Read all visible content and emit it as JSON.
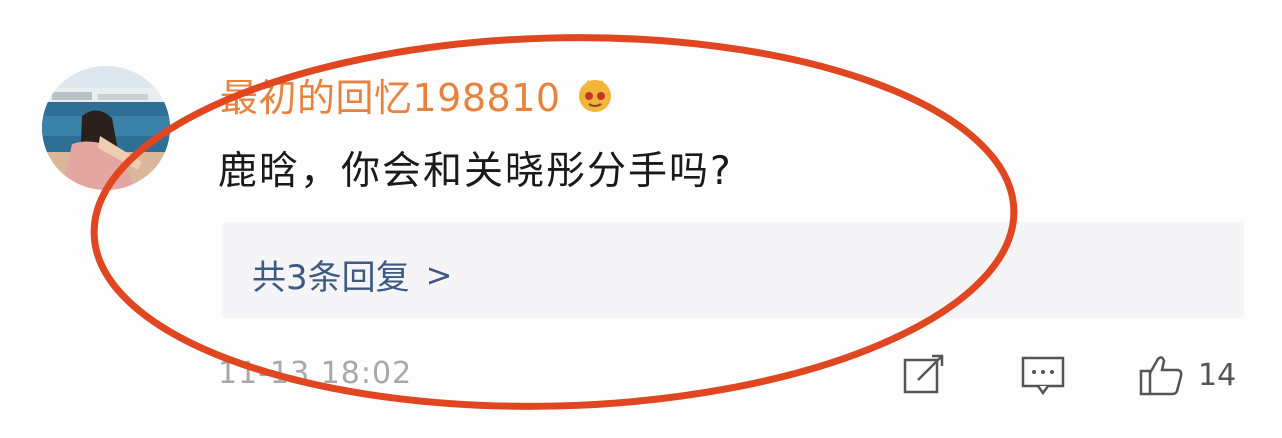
{
  "comment": {
    "username": "最初的回忆198810",
    "badge_icon": "crown-face-icon",
    "text": "鹿晗，你会和关晓彤分手吗?",
    "replies_label": "共3条回复",
    "replies_chevron": ">",
    "timestamp": "11-13 18:02",
    "like_count": "14"
  },
  "colors": {
    "username": "#e8823c",
    "reply_link": "#3f5a82",
    "highlight_ellipse": "#e0461f"
  },
  "icons": {
    "share": "share-edit-icon",
    "comment": "comment-bubble-icon",
    "like": "thumbs-up-icon"
  }
}
